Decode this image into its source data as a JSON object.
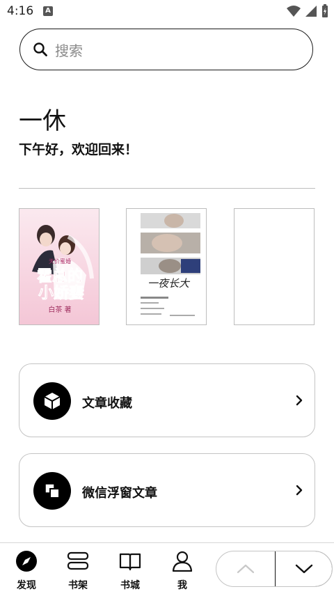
{
  "status_bar": {
    "time": "4:16",
    "notification_badge": "A"
  },
  "search": {
    "placeholder": "搜索"
  },
  "profile": {
    "name": "一休",
    "greeting": "下午好，欢迎回来！"
  },
  "books": [
    {
      "title": "霍总的小娇妻",
      "series": "天价蜜婚",
      "author": "白茶",
      "author_suffix": "著"
    },
    {
      "title": "一夜长大"
    },
    {
      "title": ""
    }
  ],
  "menu": {
    "items": [
      {
        "label": "文章收藏",
        "icon": "cube-icon"
      },
      {
        "label": "微信浮窗文章",
        "icon": "floating-window-icon"
      }
    ]
  },
  "bottom_nav": {
    "items": [
      {
        "label": "发现",
        "icon": "compass-icon"
      },
      {
        "label": "书架",
        "icon": "bookshelf-icon"
      },
      {
        "label": "书城",
        "icon": "open-book-icon"
      },
      {
        "label": "我",
        "icon": "user-icon"
      }
    ]
  },
  "colors": {
    "accent": "#000000",
    "border": "#c4c4c4",
    "placeholder": "#8a8a8a",
    "book1_tint": "#f6d3e0"
  }
}
